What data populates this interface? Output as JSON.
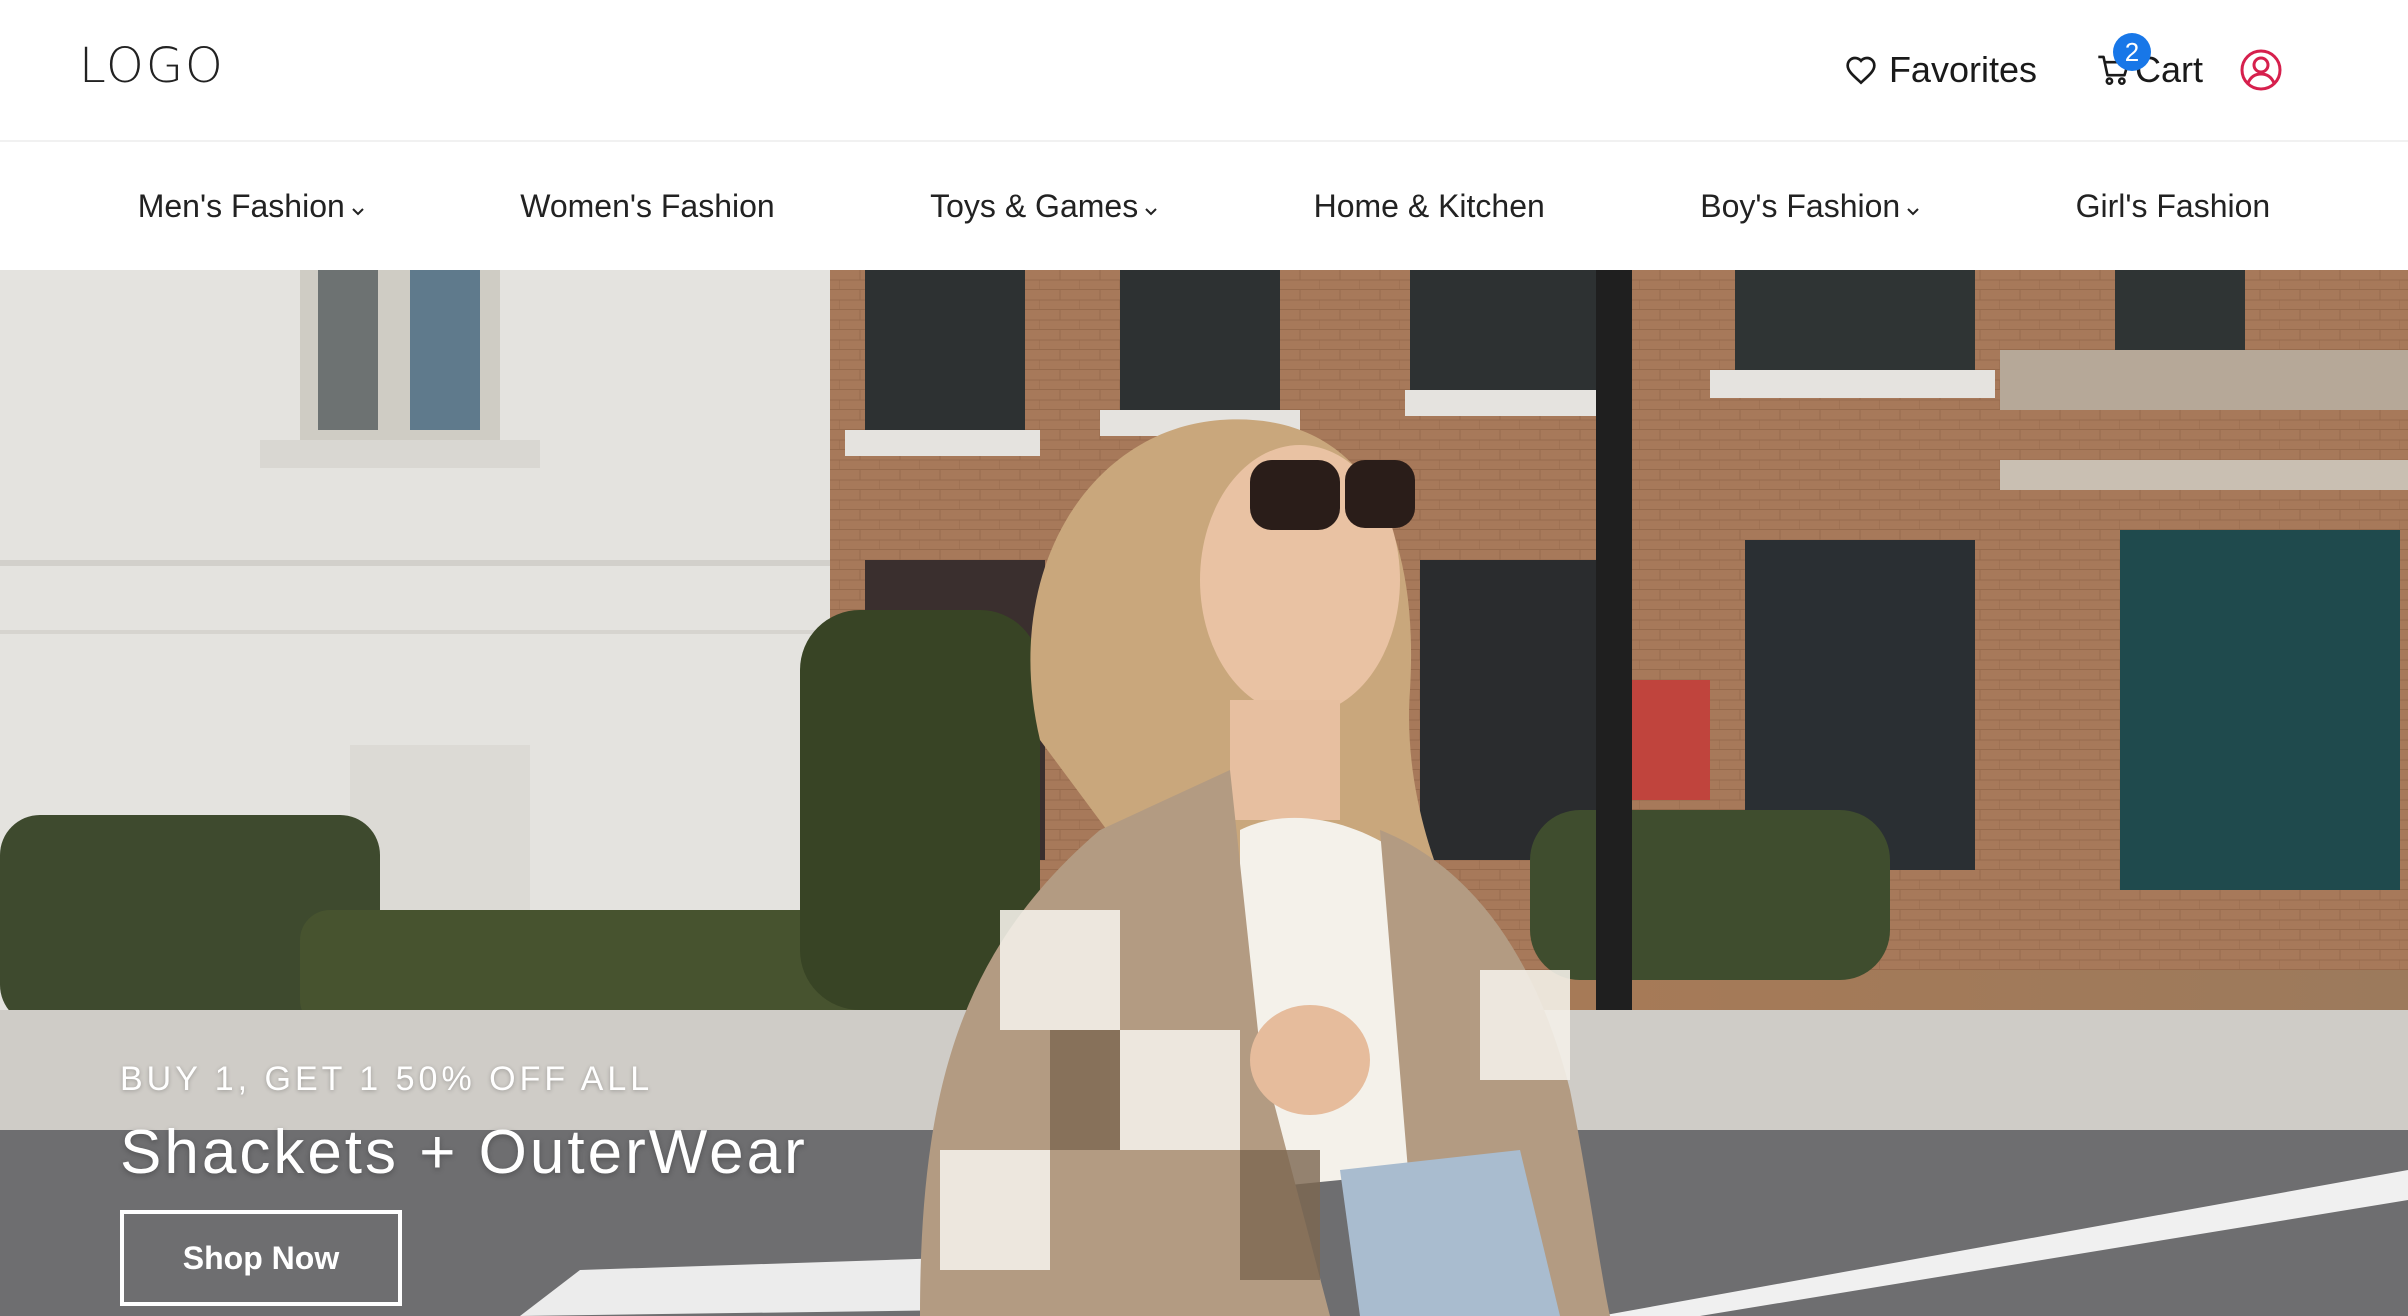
{
  "header": {
    "logo": "LOGO",
    "favorites_label": "Favorites",
    "cart_label": "Cart",
    "cart_count": "2"
  },
  "icons": {
    "favorites": "heart-icon",
    "cart": "shopping-cart-icon",
    "account": "user-circle-icon",
    "dropdown": "chevron-down-icon"
  },
  "nav": {
    "categories": [
      {
        "label": "Men's Fashion",
        "has_dropdown": true
      },
      {
        "label": "Women's Fashion",
        "has_dropdown": false
      },
      {
        "label": "Toys & Games",
        "has_dropdown": true
      },
      {
        "label": "Home & Kitchen",
        "has_dropdown": false
      },
      {
        "label": "Boy's Fashion",
        "has_dropdown": true
      },
      {
        "label": "Girl's Fashion",
        "has_dropdown": false
      }
    ]
  },
  "hero": {
    "promo": "BUY 1, GET 1 50% OFF ALL",
    "headline": "Shackets + OuterWear",
    "cta_label": "Shop Now"
  },
  "colors": {
    "badge": "#1877e8",
    "account_icon": "#d6204d",
    "hero_text": "#ffffff"
  }
}
